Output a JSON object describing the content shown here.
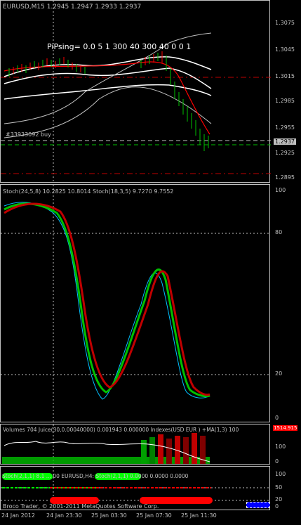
{
  "main": {
    "title": "EURUSD,M15  1.2945 1.2947 1.2933 1.2937",
    "pipsing": "PiPsing= 0.0 5  1  300  40  300  40  0  0  1",
    "order_label": "#33933092 buy",
    "price_badge": "1.2937",
    "scale": [
      "1.3075",
      "1.3045",
      "1.3015",
      "1.2985",
      "1.2955",
      "1.2925",
      "1.2895"
    ]
  },
  "stoch": {
    "title": "Stoch(24,5,8) 10.2825 10.8014  Stoch(18,3,5) 9.7270 9.7552",
    "scale": [
      "100",
      "80",
      "20",
      "0"
    ]
  },
  "volumes": {
    "title": "Volumes 704  Juice(30,0.00040000) 0.001943 0.000000  Indexes(USD EUR ) +MA(1,3) 100",
    "badge": "1514.915",
    "scale": [
      "100",
      "0"
    ]
  },
  "signal": {
    "title": "Stoch(2,1,1) 8.1 ...                    00  EURUSD,H4: Stoch(2,1,1) 0.0000 0.0000 0.0000",
    "footer": "Broco Trader, © 2001-2011 MetaQuotes Software Corp.",
    "scale": [
      "100",
      "50",
      "20",
      "0"
    ]
  },
  "time_axis": [
    "24 Jan 2012",
    "24 Jan 23:30",
    "25 Jan 03:30",
    "25 Jan 07:30",
    "25 Jan 11:30"
  ],
  "colors": {
    "frame": "#c0c0c0",
    "bull": "#ff0000",
    "bear": "#00c000",
    "envelope": "#ffffff",
    "stoch_main": "#00c000",
    "stoch_signal": "#c00000",
    "stoch_fast": "#00c0ff",
    "signal_green": "#00ff00",
    "signal_red": "#ff0000",
    "marker_blue": "#0000ff"
  }
}
